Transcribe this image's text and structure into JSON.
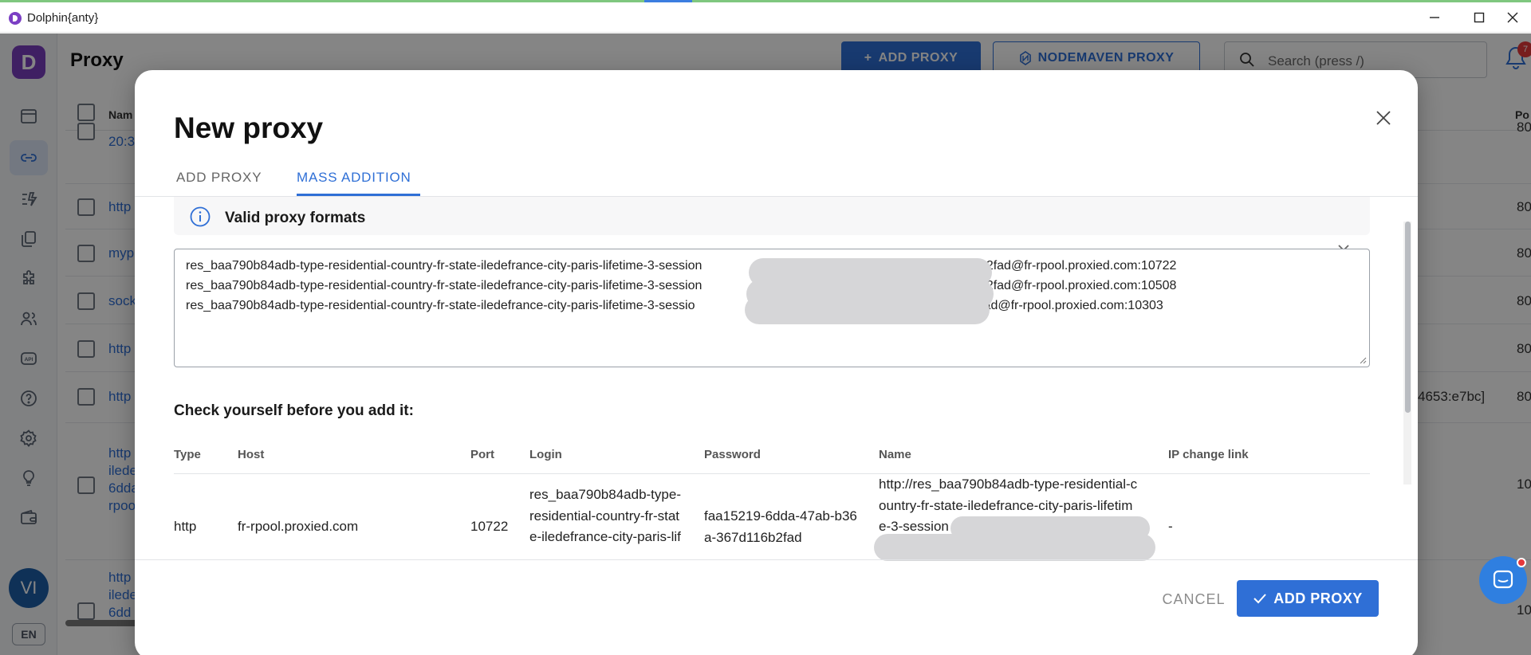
{
  "window": {
    "title": "Dolphin{anty}"
  },
  "sidebar": {
    "logo_letter": "D",
    "avatar": "VI",
    "language": "EN"
  },
  "header": {
    "title": "Proxy",
    "add_proxy": "ADD PROXY",
    "nodemaven": "NODEMAVEN PROXY",
    "search_placeholder": "Search (press /)",
    "notif_count": "7"
  },
  "background_table": {
    "col_name": "Nam",
    "col_port": "Po",
    "rows": [
      {
        "name": "20:3",
        "port": "80"
      },
      {
        "name": "http",
        "port": "80"
      },
      {
        "name": "myp",
        "port": "80"
      },
      {
        "name": "sock",
        "port": "80"
      },
      {
        "name": "http",
        "port": "80"
      },
      {
        "name": "http",
        "extra": "4653:e7bc]",
        "port": "80"
      },
      {
        "name_lines": [
          "http",
          "ilede",
          "6dda",
          "rpoo"
        ],
        "port": "10"
      },
      {
        "name_lines": [
          "http",
          "ilede",
          "6dd"
        ],
        "port": "10"
      }
    ]
  },
  "modal": {
    "title": "New proxy",
    "tabs": [
      {
        "label": "ADD PROXY"
      },
      {
        "label": "MASS ADDITION"
      }
    ],
    "accordion_title": "Valid proxy formats",
    "textarea_lines": [
      {
        "prefix": "res_baa790b84adb-type-residential-country-fr-state-iledefrance-city-paris-lifetime-3-session",
        "suffix": "116b2fad@fr-rpool.proxied.com:10722"
      },
      {
        "prefix": "res_baa790b84adb-type-residential-country-fr-state-iledefrance-city-paris-lifetime-3-session",
        "suffix": "116b2fad@fr-rpool.proxied.com:10508"
      },
      {
        "prefix": "res_baa790b84adb-type-residential-country-fr-state-iledefrance-city-paris-lifetime-3-sessio",
        "suffix": "16b2fad@fr-rpool.proxied.com:10303"
      }
    ],
    "check_title": "Check yourself before you add it:",
    "preview_table": {
      "headers": {
        "type": "Type",
        "host": "Host",
        "port": "Port",
        "login": "Login",
        "password": "Password",
        "name": "Name",
        "ip_change": "IP change link"
      },
      "row": {
        "type": "http",
        "host": "fr-rpool.proxied.com",
        "port": "10722",
        "login_lines": [
          "res_baa790b84adb-type-",
          "residential-country-fr-stat",
          "e-iledefrance-city-paris-lif"
        ],
        "password_lines": [
          "faa15219-6dda-47ab-b36",
          "a-367d116b2fad"
        ],
        "name_lines": [
          "http://res_baa790b84adb-type-residential-c",
          "ountry-fr-state-iledefrance-city-paris-lifetim",
          "e-3-session"
        ],
        "ip_change": "-"
      }
    },
    "cancel": "CANCEL",
    "add_proxy": "ADD PROXY"
  }
}
